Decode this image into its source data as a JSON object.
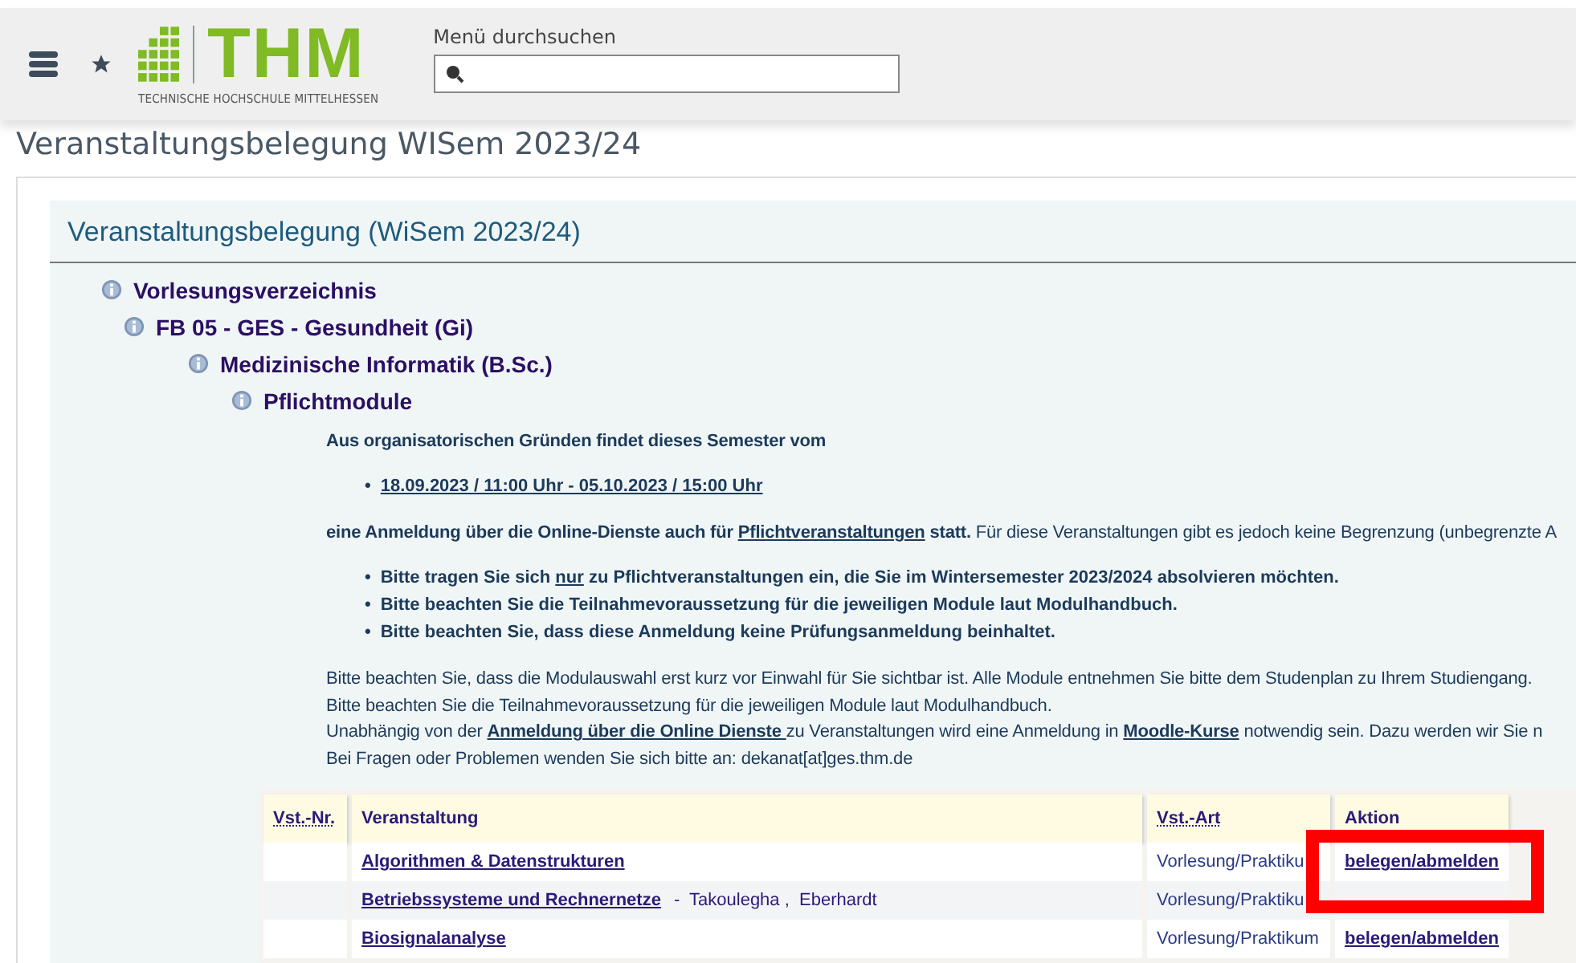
{
  "header": {
    "logo": {
      "wordmark": "THM",
      "subtitle": "TECHNISCHE HOCHSCHULE MITTELHESSEN"
    },
    "search": {
      "label": "Menü durchsuchen"
    }
  },
  "page_title": "Veranstaltungsbelegung WISem 2023/24",
  "panel": {
    "title": "Veranstaltungsbelegung (WiSem 2023/24)",
    "tree": [
      {
        "label": "Vorlesungsverzeichnis",
        "children": [
          {
            "label": "FB 05 - GES - Gesundheit (Gi)",
            "children": [
              {
                "label": "Medizinische Informatik (B.Sc.)",
                "children": [
                  {
                    "label": "Pflichtmodule"
                  }
                ]
              }
            ]
          }
        ]
      }
    ],
    "blocks": [
      {
        "kind": "para",
        "segments": [
          {
            "kind": "bold",
            "text": "Aus organisatorischen Gründen findet dieses Semester vom"
          }
        ]
      },
      {
        "kind": "bullets",
        "marker": "•",
        "items": [
          [
            {
              "kind": "link",
              "text": "18.09.2023 / 11:00 Uhr - 05.10.2023 / 15:00 Uhr"
            }
          ]
        ]
      },
      {
        "kind": "para",
        "segments": [
          {
            "kind": "bold",
            "text": "eine Anmeldung über die Online-Dienste auch für "
          },
          {
            "kind": "link",
            "text": "Pflichtveranstaltungen"
          },
          {
            "kind": "bold",
            "text": " statt."
          },
          {
            "kind": "plain",
            "text": " Für diese Veranstaltungen gibt es jedoch keine Begrenzung (unbegrenzte A"
          }
        ]
      },
      {
        "kind": "bullets",
        "marker": "•",
        "items": [
          [
            {
              "kind": "bold",
              "text": "Bitte tragen Sie sich "
            },
            {
              "kind": "link",
              "text": "nur"
            },
            {
              "kind": "bold",
              "text": " zu Pflichtveranstaltungen ein, die Sie im Wintersemester 2023/2024 absolvieren möchten."
            }
          ],
          [
            {
              "kind": "bold",
              "text": "Bitte beachten Sie die Teilnahmevoraussetzung für die jeweiligen Module laut Modulhandbuch."
            }
          ],
          [
            {
              "kind": "bold",
              "text": "Bitte beachten Sie, dass diese Anmeldung keine Prüfungsanmeldung beinhaltet."
            }
          ]
        ]
      },
      {
        "kind": "lines",
        "items": [
          [
            {
              "kind": "plain",
              "text": "Bitte beachten Sie, dass die Modulauswahl erst kurz vor Einwahl für Sie sichtbar ist. Alle Module entnehmen Sie bitte dem Studenplan zu Ihrem Studiengang."
            }
          ],
          [
            {
              "kind": "plain",
              "text": "Bitte beachten Sie die Teilnahmevoraussetzung für die jeweiligen Module laut Modulhandbuch."
            }
          ],
          [
            {
              "kind": "plain",
              "text": "Unabhängig von der "
            },
            {
              "kind": "link",
              "text": "Anmeldung über die Online Dienste "
            },
            {
              "kind": "plain",
              "text": "zu Veranstaltungen wird eine Anmeldung in "
            },
            {
              "kind": "link",
              "text": "Moodle-Kurse"
            },
            {
              "kind": "plain",
              "text": " notwendig sein. Dazu werden wir Sie n"
            }
          ],
          [
            {
              "kind": "plain",
              "text": "Bei Fragen oder Problemen wenden Sie sich bitte an: dekanat[at]ges.thm.de"
            }
          ]
        ]
      }
    ],
    "table": {
      "columns": [
        "Vst.-Nr.",
        "Veranstaltung",
        "Vst.-Art",
        "Aktion"
      ],
      "rows": [
        {
          "name": "Algorithmen & Datenstrukturen",
          "type": "Vorlesung/Praktiku",
          "action": "belegen/abmelden"
        },
        {
          "name": "Betriebssysteme und Rechnernetze",
          "lecturers": "-  Takoulegha ,  Eberhardt",
          "type": "Vorlesung/Praktiku"
        },
        {
          "name": "Biosignalanalyse",
          "type": "Vorlesung/Praktikum",
          "action": "belegen/abmelden"
        }
      ]
    }
  }
}
